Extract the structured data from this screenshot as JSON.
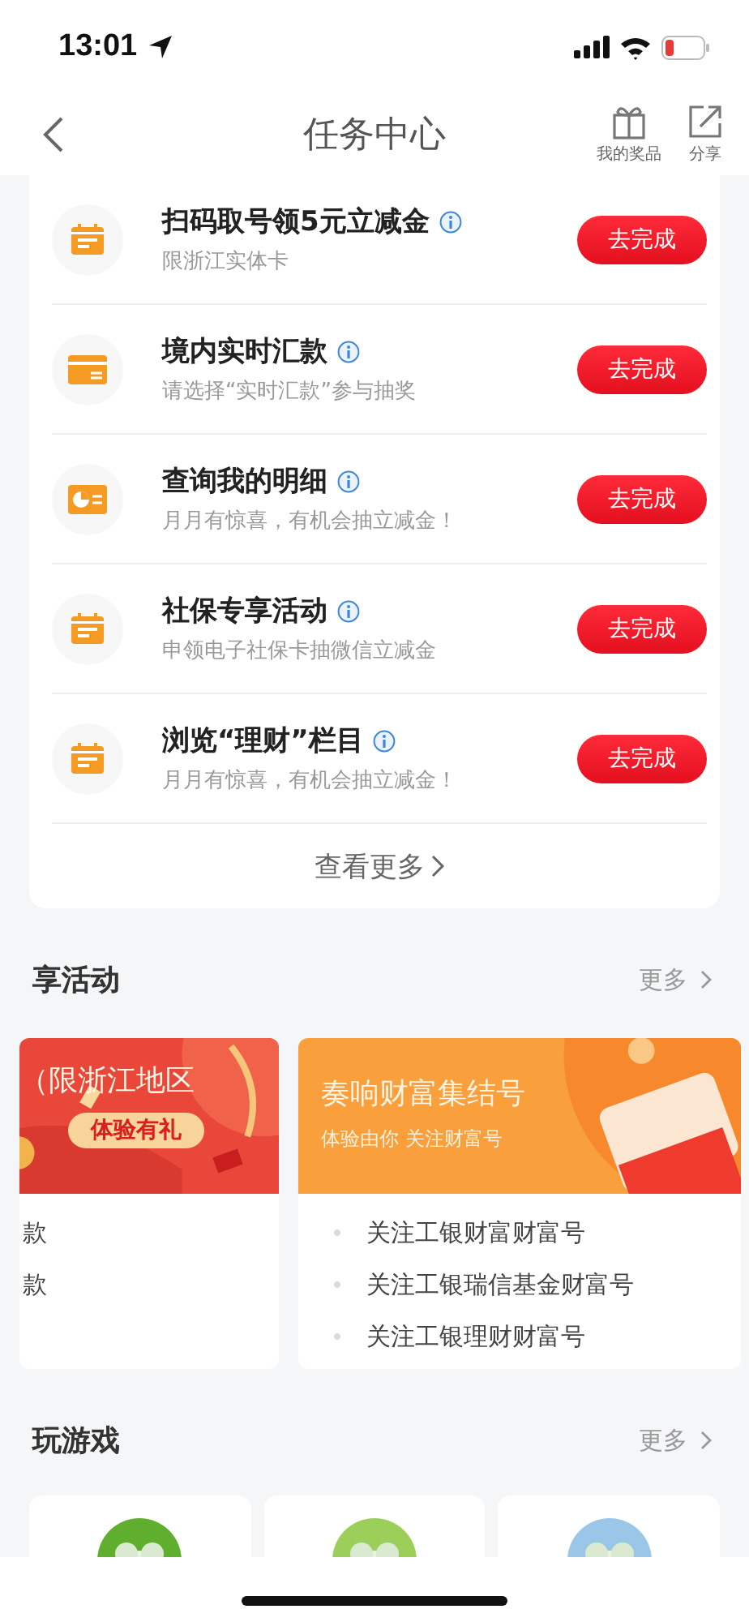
{
  "status_bar": {
    "time": "13:01"
  },
  "nav": {
    "title": "任务中心",
    "actions": [
      {
        "kind": "gift",
        "label": "我的奖品"
      },
      {
        "kind": "share",
        "label": "分享"
      }
    ]
  },
  "tasks": [
    {
      "kind": "calendar",
      "title": "扫码取号领5元立减金",
      "subtitle": "限浙江实体卡",
      "button": "去完成"
    },
    {
      "kind": "card",
      "title": "境内实时汇款",
      "subtitle": "请选择“实时汇款”参与抽奖",
      "button": "去完成"
    },
    {
      "kind": "chart",
      "title": "查询我的明细",
      "subtitle": "月月有惊喜，有机会抽立减金！",
      "button": "去完成"
    },
    {
      "kind": "calendar",
      "title": "社保专享活动",
      "subtitle": "申领电子社保卡抽微信立减金",
      "button": "去完成"
    },
    {
      "kind": "calendar",
      "title": "浏览“理财”栏目",
      "subtitle": "月月有惊喜，有机会抽立减金！",
      "button": "去完成"
    }
  ],
  "see_more": "查看更多",
  "activities": {
    "title": "享活动",
    "more": "更多",
    "cards": [
      {
        "kind": "red",
        "title": "（限浙江地区",
        "badge": "体验有礼",
        "lines": [
          "款",
          "款"
        ]
      },
      {
        "kind": "orange",
        "title": "奏响财富集结号",
        "subtitle": "体验由你 关注财富号",
        "lines": [
          "关注工银财富财富号",
          "关注工银瑞信基金财富号",
          "关注工银理财财富号"
        ]
      }
    ]
  },
  "games": {
    "title": "玩游戏",
    "more": "更多",
    "cards": [
      {
        "kind": "green"
      },
      {
        "kind": "leaf"
      },
      {
        "kind": "blue"
      }
    ]
  }
}
